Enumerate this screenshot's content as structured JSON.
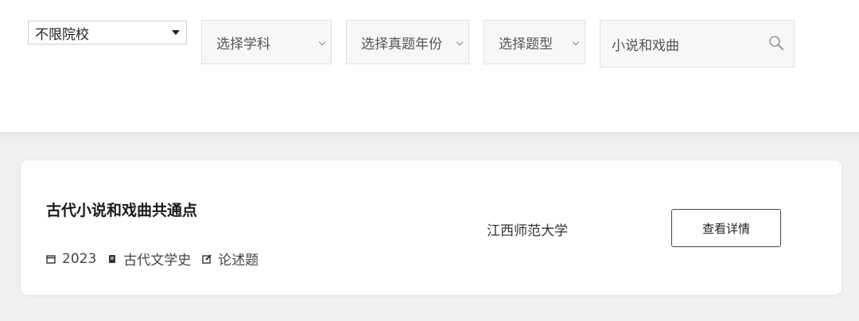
{
  "filters": {
    "school": "不限院校",
    "subject": "选择学科",
    "year": "选择真题年份",
    "type": "选择题型",
    "search_value": "小说和戏曲"
  },
  "result": {
    "title": "古代小说和戏曲共通点",
    "year": "2023",
    "category": "古代文学史",
    "question_type": "论述题",
    "school": "江西师范大学",
    "detail_button": "查看详情"
  },
  "icons": {
    "search": "search-icon",
    "calendar": "calendar-icon",
    "book": "book-icon",
    "edit": "edit-icon"
  }
}
